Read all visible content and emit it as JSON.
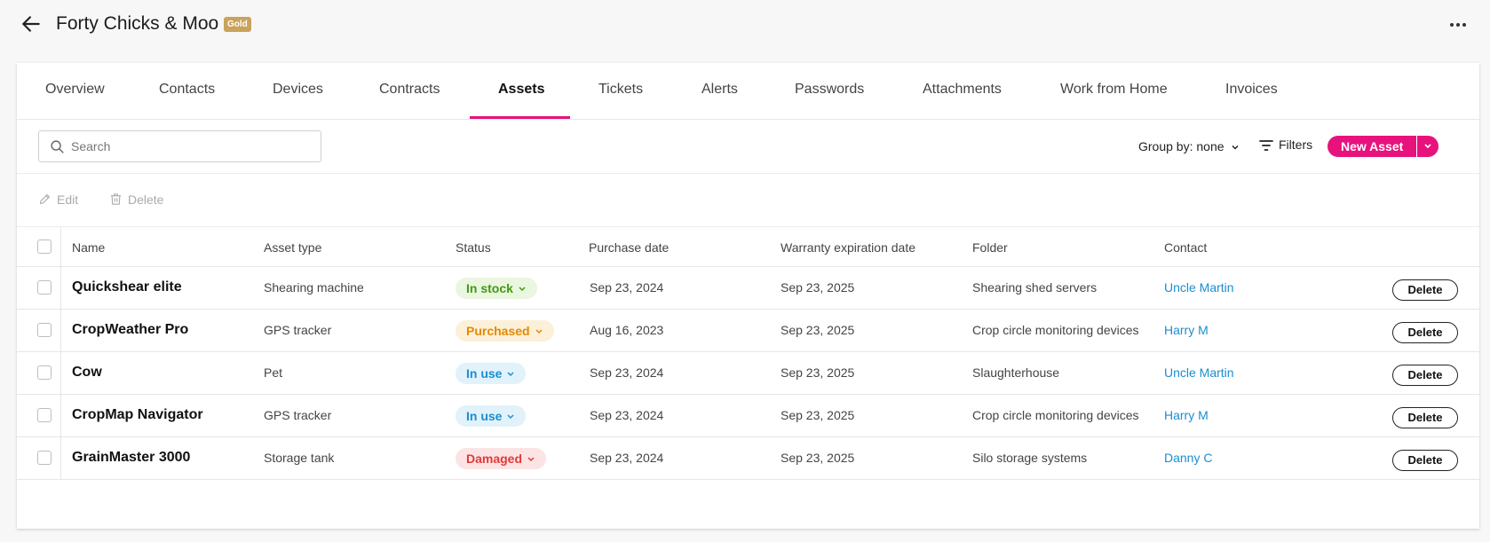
{
  "header": {
    "title": "Forty Chicks & Moo",
    "badge": "Gold"
  },
  "tabs": [
    {
      "label": "Overview"
    },
    {
      "label": "Contacts"
    },
    {
      "label": "Devices"
    },
    {
      "label": "Contracts"
    },
    {
      "label": "Assets",
      "active": true
    },
    {
      "label": "Tickets"
    },
    {
      "label": "Alerts"
    },
    {
      "label": "Passwords"
    },
    {
      "label": "Attachments"
    },
    {
      "label": "Work from Home"
    },
    {
      "label": "Invoices"
    }
  ],
  "toolbar": {
    "search_placeholder": "Search",
    "group_by": "Group by: none",
    "filters": "Filters",
    "new_asset": "New Asset"
  },
  "actions": {
    "edit": "Edit",
    "delete": "Delete"
  },
  "table": {
    "columns": [
      "Name",
      "Asset type",
      "Status",
      "Purchase date",
      "Warranty expiration date",
      "Folder",
      "Contact"
    ],
    "rows": [
      {
        "name": "Quickshear elite",
        "type": "Shearing machine",
        "status": "In stock",
        "purchase": "Sep 23, 2024",
        "warranty": "Sep 23, 2025",
        "folder": "Shearing shed servers",
        "contact": "Uncle Martin",
        "delete": "Delete"
      },
      {
        "name": "CropWeather Pro",
        "type": "GPS tracker",
        "status": "Purchased",
        "purchase": "Aug 16, 2023",
        "warranty": "Sep 23, 2025",
        "folder": "Crop circle monitoring devices",
        "contact": "Harry M",
        "delete": "Delete"
      },
      {
        "name": "Cow",
        "type": "Pet",
        "status": "In use",
        "purchase": "Sep 23, 2024",
        "warranty": "Sep 23, 2025",
        "folder": "Slaughterhouse",
        "contact": "Uncle Martin",
        "delete": "Delete"
      },
      {
        "name": "CropMap Navigator",
        "type": "GPS tracker",
        "status": "In use",
        "purchase": "Sep 23, 2024",
        "warranty": "Sep 23, 2025",
        "folder": "Crop circle monitoring devices",
        "contact": "Harry M",
        "delete": "Delete"
      },
      {
        "name": "GrainMaster 3000",
        "type": "Storage tank",
        "status": "Damaged",
        "purchase": "Sep 23, 2024",
        "warranty": "Sep 23, 2025",
        "folder": "Silo storage systems",
        "contact": "Danny C",
        "delete": "Delete"
      }
    ]
  },
  "status_colors": {
    "In stock": {
      "bg": "#eaf6df",
      "fg": "#3f9a14"
    },
    "Purchased": {
      "bg": "#fdf0d8",
      "fg": "#e28a05"
    },
    "In use": {
      "bg": "#e1f2fb",
      "fg": "#1a8ed0"
    },
    "Damaged": {
      "bg": "#fde4e4",
      "fg": "#e03a3a"
    }
  },
  "colors": {
    "accent": "#e5127d",
    "link": "#1a8ed0",
    "gold": "#c9a35a"
  }
}
